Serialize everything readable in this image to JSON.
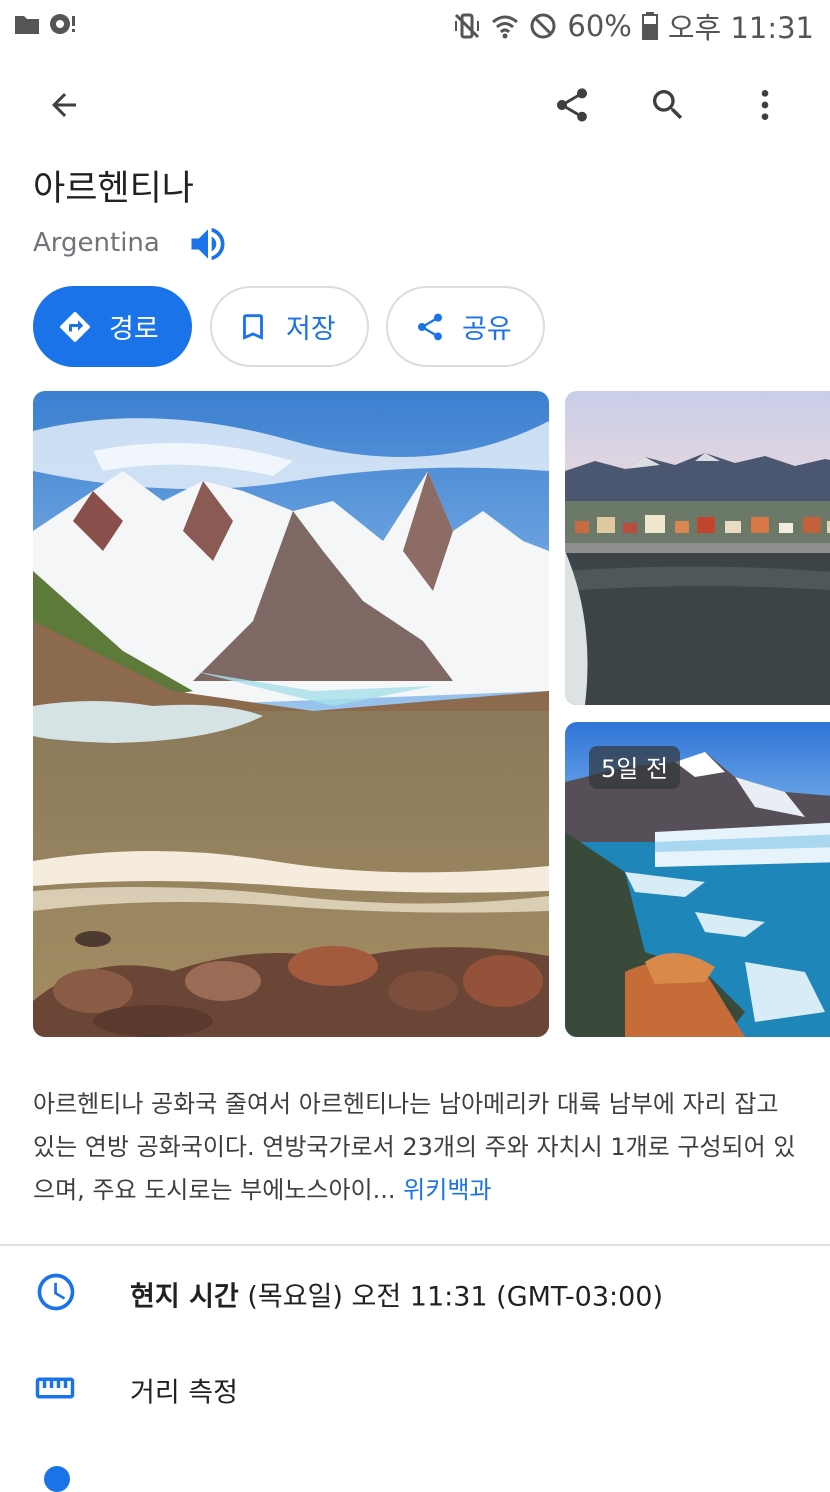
{
  "status_bar": {
    "battery": "60%",
    "time": "오후 11:31",
    "icons": [
      "folder-icon",
      "record-icon",
      "mute-vibrate-icon",
      "wifi-icon",
      "do-not-disturb-icon",
      "battery-icon"
    ]
  },
  "app_bar": {
    "icons": [
      "back-arrow-icon",
      "share-icon",
      "search-icon",
      "more-vert-icon"
    ]
  },
  "place": {
    "title": "아르헨티나",
    "subtitle": "Argentina"
  },
  "actions": {
    "route": "경로",
    "save": "저장",
    "share": "공유"
  },
  "photos": {
    "badge": "5일 전"
  },
  "description": {
    "text": "아르헨티나 공화국 줄여서 아르헨티나는 남아메리카 대륙 남부에 자리 잡고 있는 연방 공화국이다. 연방국가로서 23개의 주와 자치시 1개로 구성되어 있으며, 주요 도시로는 부에노스아이...",
    "more_link": "위키백과"
  },
  "info_rows": {
    "local_time_label": "현지 시간",
    "local_time_value": " (목요일) 오전 11:31 (GMT-03:00)",
    "measure_distance": "거리 측정"
  },
  "colors": {
    "accent": "#1a73e8",
    "text_primary": "#202124",
    "text_secondary": "#70757a"
  }
}
